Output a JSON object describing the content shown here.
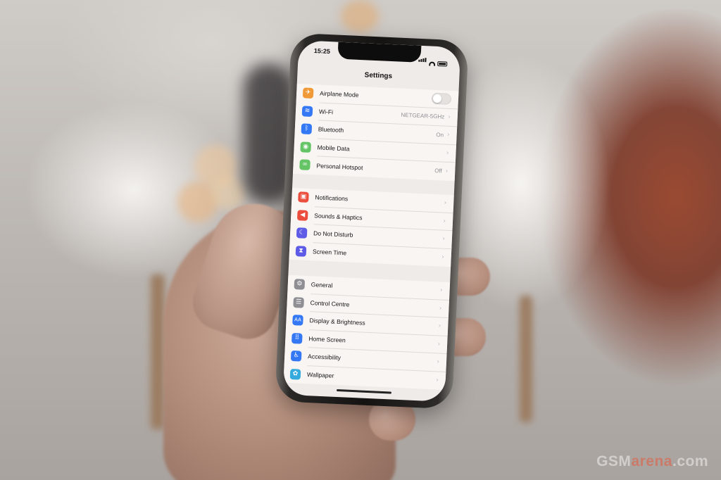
{
  "status_bar": {
    "time": "15:25"
  },
  "nav": {
    "title": "Settings"
  },
  "groups": [
    {
      "rows": [
        {
          "icon": "airplane-icon",
          "color": "#f09a37",
          "glyph": "✈",
          "label": "Airplane Mode",
          "toggle": false
        },
        {
          "icon": "wifi-icon",
          "color": "#3478f6",
          "glyph": "≋",
          "label": "Wi-Fi",
          "value": "NETGEAR-5GHz"
        },
        {
          "icon": "bluetooth-icon",
          "color": "#3478f6",
          "glyph": "ᛒ",
          "label": "Bluetooth",
          "value": "On"
        },
        {
          "icon": "mobile-data-icon",
          "color": "#65c466",
          "glyph": "◉",
          "label": "Mobile Data"
        },
        {
          "icon": "hotspot-icon",
          "color": "#65c466",
          "glyph": "∞",
          "label": "Personal Hotspot",
          "value": "Off"
        }
      ]
    },
    {
      "rows": [
        {
          "icon": "notifications-icon",
          "color": "#eb4e3d",
          "glyph": "▣",
          "label": "Notifications"
        },
        {
          "icon": "sounds-icon",
          "color": "#eb4e3d",
          "glyph": "◀",
          "label": "Sounds & Haptics"
        },
        {
          "icon": "moon-icon",
          "color": "#5e5ce6",
          "glyph": "☾",
          "label": "Do Not Disturb"
        },
        {
          "icon": "hourglass-icon",
          "color": "#5e5ce6",
          "glyph": "⧗",
          "label": "Screen Time"
        }
      ]
    },
    {
      "rows": [
        {
          "icon": "gear-icon",
          "color": "#8e8e93",
          "glyph": "⚙",
          "label": "General"
        },
        {
          "icon": "control-centre-icon",
          "color": "#8e8e93",
          "glyph": "☰",
          "label": "Control Centre"
        },
        {
          "icon": "display-icon",
          "color": "#3478f6",
          "glyph": "AA",
          "label": "Display & Brightness"
        },
        {
          "icon": "home-screen-icon",
          "color": "#3478f6",
          "glyph": "⠿",
          "label": "Home Screen"
        },
        {
          "icon": "accessibility-icon",
          "color": "#3478f6",
          "glyph": "♿",
          "label": "Accessibility"
        },
        {
          "icon": "wallpaper-icon",
          "color": "#35aadc",
          "glyph": "✿",
          "label": "Wallpaper"
        }
      ]
    }
  ],
  "watermark": {
    "part1": "GSM",
    "part2": "arena",
    "part3": ".com"
  }
}
